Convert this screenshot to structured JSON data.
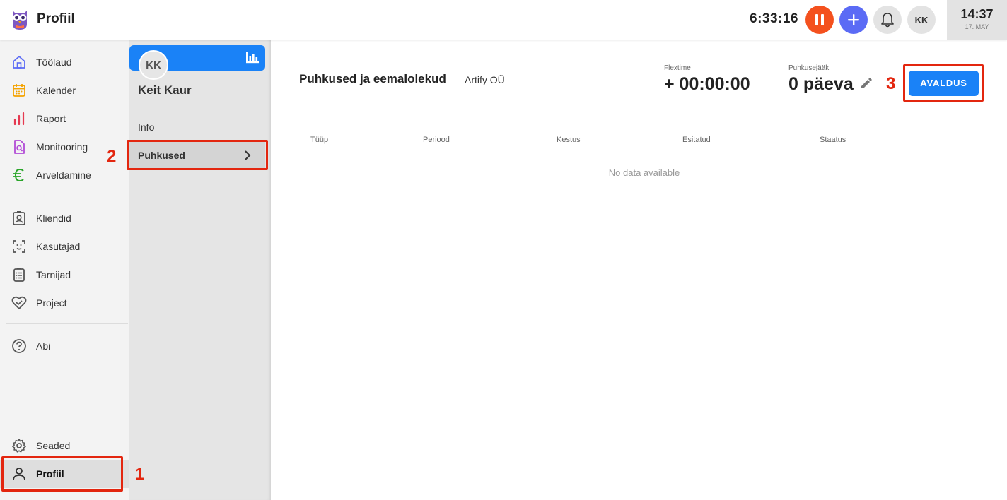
{
  "app": {
    "title": "Profiil"
  },
  "topbar": {
    "timer": "6:33:16",
    "avatar_initials": "KK",
    "clock_time": "14:37",
    "clock_date": "17. MAY"
  },
  "nav": {
    "items": [
      {
        "label": "Töölaud",
        "icon": "home-icon"
      },
      {
        "label": "Kalender",
        "icon": "calendar-icon"
      },
      {
        "label": "Raport",
        "icon": "chart-icon"
      },
      {
        "label": "Monitooring",
        "icon": "monitoring-icon"
      },
      {
        "label": "Arveldamine",
        "icon": "euro-icon"
      },
      {
        "label": "Kliendid",
        "icon": "clients-icon"
      },
      {
        "label": "Kasutajad",
        "icon": "users-icon"
      },
      {
        "label": "Tarnijad",
        "icon": "suppliers-icon"
      },
      {
        "label": "Project",
        "icon": "project-icon"
      },
      {
        "label": "Abi",
        "icon": "help-icon"
      },
      {
        "label": "Seaded",
        "icon": "gear-icon"
      },
      {
        "label": "Profiil",
        "icon": "person-icon"
      }
    ],
    "active": "Profiil"
  },
  "profile": {
    "initials": "KK",
    "name": "Keit Kaur",
    "menu": [
      {
        "label": "Info"
      },
      {
        "label": "Puhkused"
      }
    ]
  },
  "main": {
    "title": "Puhkused ja eemalolekud",
    "company": "Artify OÜ",
    "flextime_label": "Flextime",
    "flextime_value": "+ 00:00:00",
    "balance_label": "Puhkusejääk",
    "balance_value": "0 päeva",
    "button_label": "AVALDUS",
    "table": {
      "headers": [
        "Tüüp",
        "Periood",
        "Kestus",
        "Esitatud",
        "Staatus"
      ],
      "empty_text": "No data available"
    }
  },
  "annotations": [
    "1",
    "2",
    "3"
  ],
  "colors": {
    "accent_blue": "#1a82f7",
    "pause_orange": "#f4511e",
    "add_indigo": "#5b6bf5",
    "annotation_red": "#e3260f"
  }
}
